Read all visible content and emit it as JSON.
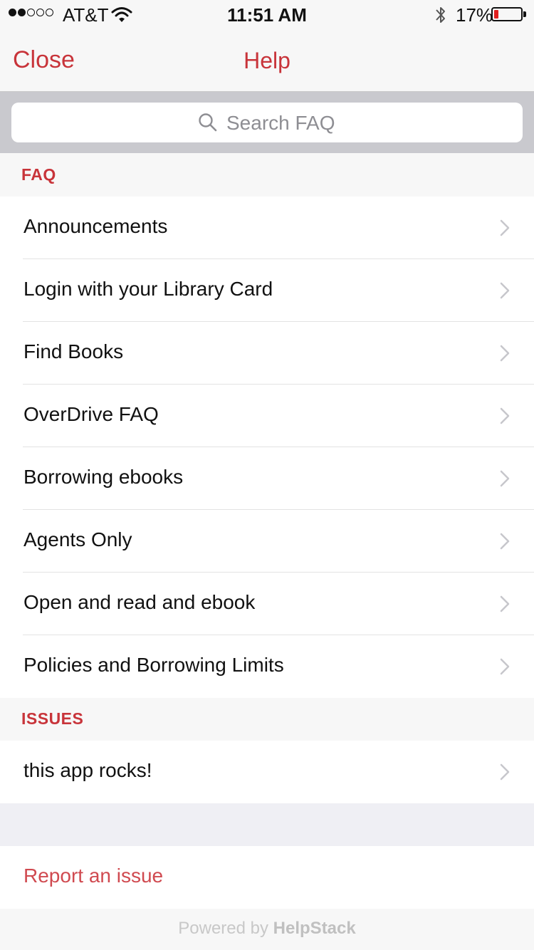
{
  "status_bar": {
    "carrier": "AT&T",
    "time": "11:51 AM",
    "battery_percent": "17%",
    "battery_level": 0.17,
    "signal_bars_filled": 2,
    "signal_bars_total": 5
  },
  "nav": {
    "close_label": "Close",
    "title": "Help"
  },
  "search": {
    "placeholder": "Search FAQ"
  },
  "faq": {
    "header": "FAQ",
    "items": [
      {
        "label": "Announcements"
      },
      {
        "label": "Login with your Library Card"
      },
      {
        "label": "Find Books"
      },
      {
        "label": "OverDrive FAQ"
      },
      {
        "label": "Borrowing ebooks"
      },
      {
        "label": "Agents Only"
      },
      {
        "label": "Open and read and ebook"
      },
      {
        "label": "Policies and Borrowing Limits"
      }
    ]
  },
  "issues": {
    "header": "ISSUES",
    "items": [
      {
        "label": "this app rocks!"
      }
    ]
  },
  "report_issue_label": "Report an issue",
  "powered_by": {
    "prefix": "Powered by",
    "brand": "HelpStack"
  },
  "colors": {
    "accent": "#c8343a",
    "battery_low": "#e02020"
  },
  "icons": [
    "wifi-icon",
    "bluetooth-icon",
    "battery-icon",
    "search-icon",
    "chevron-right-icon"
  ]
}
